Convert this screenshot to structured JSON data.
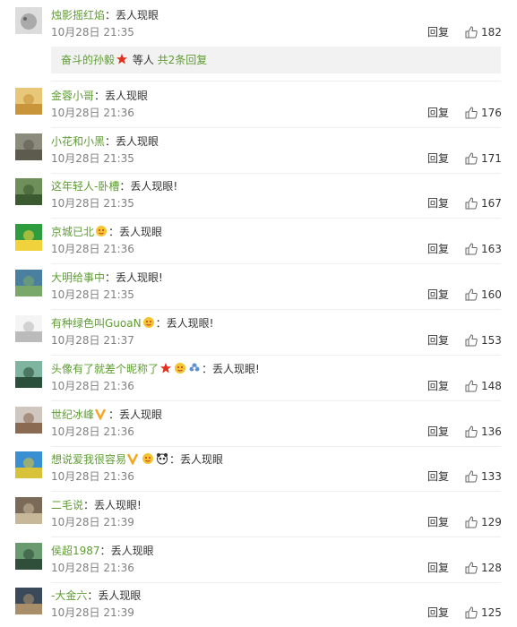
{
  "reply_label": "回复",
  "first_comment": {
    "user": "烛影摇红焰",
    "colon": "：",
    "text": "丢人现眼",
    "time": "10月28日 21:35",
    "likes": "182"
  },
  "subreplies": {
    "user": "奋斗的孙毅",
    "etc": " 等人 ",
    "count": "共2条回复"
  },
  "comments": [
    {
      "user": "金蓉小哥",
      "colon": "：",
      "text": "丢人现眼",
      "time": "10月28日 21:36",
      "likes": "176"
    },
    {
      "user": "小花和小黑",
      "colon": "：",
      "text": "丢人现眼",
      "time": "10月28日 21:35",
      "likes": "171"
    },
    {
      "user": "这年轻人-卧槽",
      "colon": "：",
      "text": "丢人现眼!",
      "time": "10月28日 21:35",
      "likes": "167"
    },
    {
      "user": "京城已北",
      "colon": "：",
      "text": "丢人现眼",
      "time": "10月28日 21:36",
      "likes": "163"
    },
    {
      "user": "大明给事中",
      "colon": "：",
      "text": "丢人现眼!",
      "time": "10月28日 21:35",
      "likes": "160"
    },
    {
      "user": "有种绿色叫GuoaN",
      "colon": "：",
      "text": "丢人现眼!",
      "time": "10月28日 21:37",
      "likes": "153"
    },
    {
      "user": "头像有了就差个昵称了",
      "colon": "：",
      "text": "丢人现眼!",
      "time": "10月28日 21:36",
      "likes": "148"
    },
    {
      "user": "世纪冰峰",
      "colon": "：",
      "text": "丢人现眼",
      "time": "10月28日 21:36",
      "likes": "136"
    },
    {
      "user": "想说爱我很容易",
      "colon": "：",
      "text": "丢人现眼",
      "time": "10月28日 21:36",
      "likes": "133"
    },
    {
      "user": "二毛说",
      "colon": "：",
      "text": "丢人现眼!",
      "time": "10月28日 21:39",
      "likes": "129"
    },
    {
      "user": "侯超1987",
      "colon": "：",
      "text": "丢人现眼",
      "time": "10月28日 21:36",
      "likes": "128"
    },
    {
      "user": "-大金六",
      "colon": "：",
      "text": "丢人现眼",
      "time": "10月28日 21:39",
      "likes": "125"
    }
  ]
}
